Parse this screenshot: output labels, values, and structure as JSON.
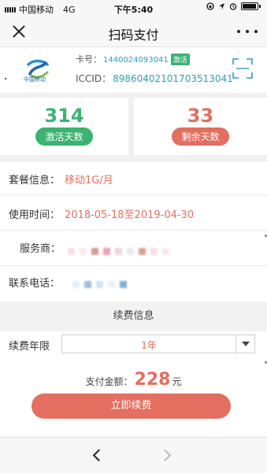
{
  "status_bar": {
    "carrier": "中国移动",
    "network": "4G",
    "time": "下午5:40"
  },
  "nav": {
    "title": "扫码支付",
    "close_icon": "close-icon",
    "more_icon": "more-icon"
  },
  "card": {
    "logo_text": "中国移动",
    "card_label": "卡号：",
    "card_number": "1440024093041",
    "status_badge": "激活",
    "iccid_label": "ICCID：",
    "iccid": "89860402101703513041",
    "scan_icon": "scan-icon"
  },
  "stats": {
    "active_days": "314",
    "active_label": "激活天数",
    "remaining_days": "33",
    "remaining_label": "剩余天数",
    "active_color": "#3cb371",
    "remaining_color": "#e46e5f"
  },
  "info": {
    "plan_label": "套餐信息：",
    "plan_value": "移动1G/月",
    "period_label": "使用时间：",
    "period_value": "2018-05-18至2019-04-30",
    "provider_label": "服务商：",
    "phone_label": "联系电话："
  },
  "renew": {
    "section_title": "续费信息",
    "duration_label": "续费年限",
    "duration_value": "1年",
    "pay_label": "支付金额：",
    "pay_amount": "228",
    "pay_unit": "元",
    "button_label": "立即续费"
  },
  "colors": {
    "accent": "#e46e5f",
    "green": "#3cb371",
    "link": "#2aa0b8"
  }
}
